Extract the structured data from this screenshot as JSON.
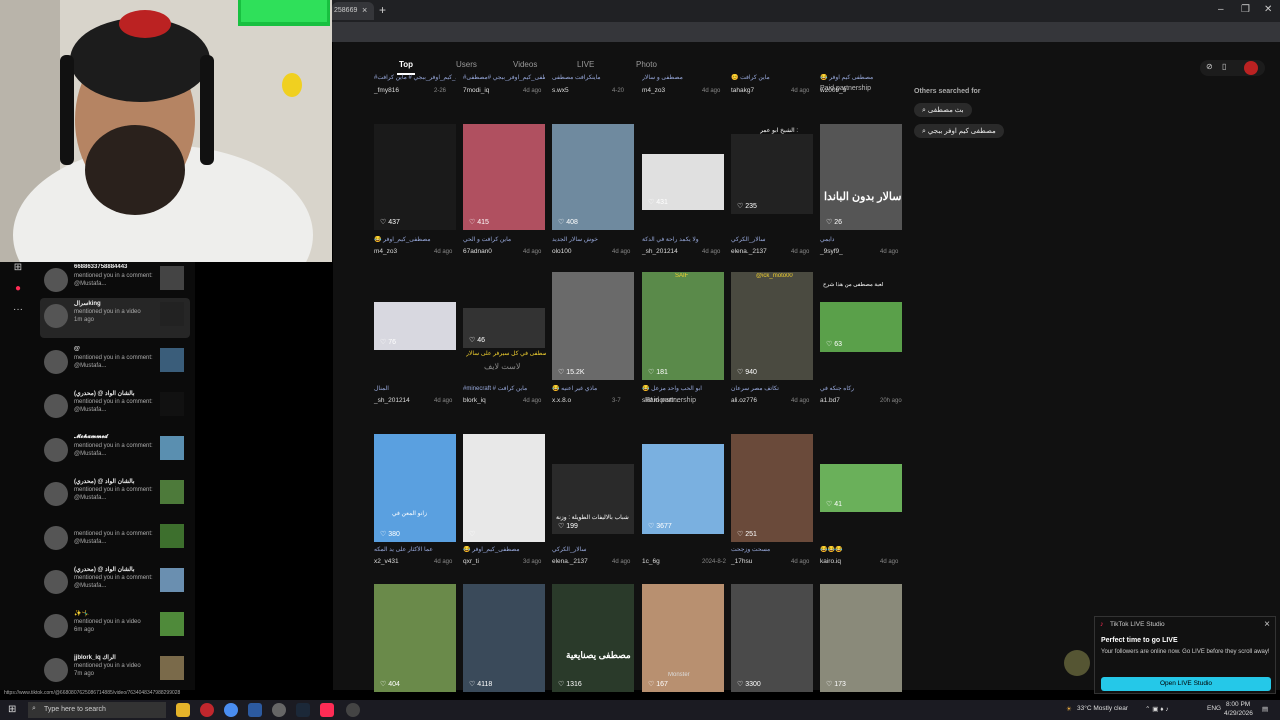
{
  "browser": {
    "tab_title": "258669",
    "tab_close": "×",
    "new_tab": "+",
    "window_controls": [
      "–",
      "❐",
      "✕"
    ]
  },
  "feed": {
    "tabs": [
      "Top",
      "Users",
      "Videos",
      "LIVE",
      "Photo"
    ],
    "row0": {
      "captions": [
        "#مصطفى_كيم_اوفر_ببجي # ماين كرافت",
        "#مصطفى_كيم_اوفر_ببجي #مصطفى",
        "ماينكرافت مصطفى",
        "مصطفى و سالار",
        "😊 ماين كرافت",
        "😂 مصطفى كيم اوفر"
      ],
      "users": [
        "_fmy816",
        "7modi_iq",
        "s.wx5",
        "m4_zo3",
        "tahakg7",
        "w2009_9"
      ],
      "dates": [
        "2-26",
        "4d ago",
        "4-20",
        "4d ago",
        "4d ago",
        ""
      ],
      "partner": "Paid partnership"
    },
    "row1": {
      "likes": [
        "437",
        "415",
        "408",
        "431",
        "235",
        "26"
      ],
      "captions": [
        "😂 مصطفى_كيم_اوفر",
        "ماين كرافت و الحي",
        "خوش سالار الجديد",
        "ولا يكمد راحة في الدكة",
        "سالار_الكركي",
        "دايمي"
      ],
      "users": [
        "m4_zo3",
        "67adnan0",
        "olo100",
        "_sh_201214",
        "elena._2137",
        "_9syf9_"
      ],
      "dates": [
        "4d ago",
        "4d ago",
        "4d ago",
        "4d ago",
        "4d ago",
        "4d ago"
      ],
      "overlay_top": "الشيخ ابو عمر :",
      "overlay_salar": "سالار بدون الباندا"
    },
    "row2": {
      "likes": [
        "76",
        "46",
        "15.2K",
        "181",
        "940",
        "63"
      ],
      "captions": [
        "المنال",
        "#minecraft # ماين كرافت",
        "😂 ماذي غير اعنيه",
        "😂 ابو الحب واحد مزعل",
        "تكاتف مصر سرعان",
        "ركاه جنكه في"
      ],
      "users": [
        "_sh_201214",
        "blork_iq",
        "x.x.8.o",
        "saif.monstlr...",
        "ali.oz776",
        "a1.bd7"
      ],
      "dates": [
        "4d ago",
        "4d ago",
        "3-7",
        "",
        "4d ago",
        "20h ago"
      ],
      "partner": "Paid partnership",
      "overlay_c2": "مصطفى في كل سيرفر على سالار",
      "overlay_c2b": "لاست لايف",
      "overlay_c6": "لعبة مصطفى من هذا شرح",
      "overlay_c5": "@ick_moto00",
      "overlay_c4": "SAIF"
    },
    "row3": {
      "likes": [
        "380",
        "",
        "199",
        "3677",
        "251",
        "41"
      ],
      "captions": [
        "عماً الأكثار على يد المكه",
        "😂 مصطفى_كيم_اوفر",
        "سالار_الكركي",
        "",
        "مسحت وزجحت",
        "😂😂😂"
      ],
      "users": [
        "x2_v431",
        "qxr_ti",
        "elena._2137",
        "1c_6g",
        "_17hsu",
        "kairo.iq"
      ],
      "dates": [
        "4d ago",
        "3d ago",
        "4d ago",
        "2024-8-2",
        "4d ago",
        "4d ago"
      ],
      "overlay_c3": "شباب بالاليفات الطويلة : وزنة",
      "overlay_c1": "زانو المعن في"
    },
    "row4": {
      "likes": [
        "404",
        "4118",
        "1316",
        "167",
        "3300",
        "173"
      ],
      "overlay_c3": "مصطفى يصنايعية",
      "overlay_c4": "Monster"
    },
    "others_title": "Others searched for",
    "others": [
      "بث مصطفى",
      "مصطفى كيم اوفر ببجي"
    ]
  },
  "sidebar": {
    "icons": [
      "plus-square",
      "live",
      "more"
    ],
    "notifications": [
      {
        "name": "6688633758884443",
        "text": "mentioned you in a comment: @Mustafa...",
        "time": ""
      },
      {
        "name": "سرالking",
        "text": "mentioned you in a video",
        "time": "1m ago"
      },
      {
        "name": "@",
        "text": "mentioned you in a comment: @Mustafa...",
        "time": ""
      },
      {
        "name": "بالشان الواد @ (محدري)",
        "text": "mentioned you in a comment: @Mustafa...",
        "time": ""
      },
      {
        "name": "𝓜𝓸𝓱𝓪𝓶𝓶𝓮𝓭",
        "text": "mentioned you in a comment: @Mustafa...",
        "time": ""
      },
      {
        "name": "بالشان الواد @ (محدري)",
        "text": "mentioned you in a comment: @Mustafa...",
        "time": ""
      },
      {
        "name": "",
        "text": "mentioned you in a comment: @Mustafa...",
        "time": ""
      },
      {
        "name": "بالشان الواد @ (محدري)",
        "text": "mentioned you in a comment: @Mustafa...",
        "time": ""
      },
      {
        "name": "✨🤸‍♂️",
        "text": "mentioned you in a video",
        "time": "6m ago"
      },
      {
        "name": "jjblork_iq الراك",
        "text": "mentioned you in a video",
        "time": "7m ago"
      }
    ]
  },
  "popup": {
    "header": "TikTok LIVE Studio",
    "title": "Perfect time to go LIVE",
    "body": "Your followers are online now. Go LIVE before they scroll away!",
    "button": "Open LIVE Studio",
    "close": "×"
  },
  "status_url": "https://www.tiktok.com/@6680807625086714885/video/7634048347988299028",
  "taskbar": {
    "search_placeholder": "Type here to search",
    "weather": "33°C  Mostly clear",
    "lang": "ENG",
    "time": "8:00 PM",
    "date": "4/29/2026"
  },
  "colors": {
    "accent": "#fe2c55",
    "live_button": "#25c8e8",
    "caption_link": "#99aadd"
  }
}
